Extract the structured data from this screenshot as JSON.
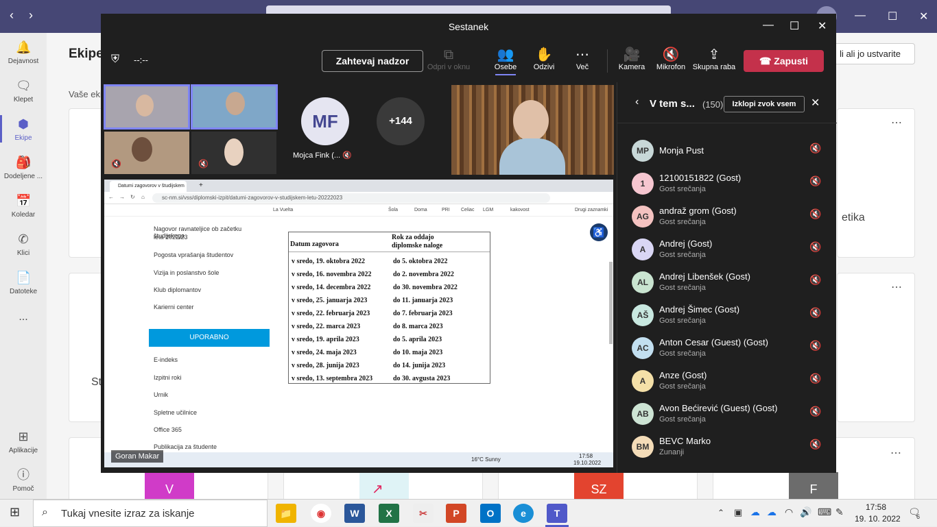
{
  "teams": {
    "page_title": "Ekipe",
    "your_teams_label": "Vaše ekipe",
    "join_create_label": "li ali jo ustvarite",
    "partial_card_text": "etika",
    "partial_card_text2": "St",
    "rail": [
      {
        "label": "Dejavnost",
        "icon": "bell-icon"
      },
      {
        "label": "Klepet",
        "icon": "chat-icon"
      },
      {
        "label": "Ekipe",
        "icon": "teams-icon"
      },
      {
        "label": "Dodeljene ...",
        "icon": "assignments-icon"
      },
      {
        "label": "Koledar",
        "icon": "calendar-icon"
      },
      {
        "label": "Klici",
        "icon": "phone-icon"
      },
      {
        "label": "Datoteke",
        "icon": "file-icon"
      },
      {
        "label": "...",
        "icon": "more-icon"
      },
      {
        "label": "Aplikacije",
        "icon": "apps-icon"
      },
      {
        "label": "Pomoč",
        "icon": "help-icon"
      }
    ],
    "card_letters": [
      "V",
      "SZ",
      "F"
    ]
  },
  "meeting": {
    "title": "Sestanek",
    "timer": "--:--",
    "request_control": "Zahtevaj nadzor",
    "toolbar": [
      {
        "label": "Odpri v oknu",
        "icon": "popout-icon",
        "disabled": true
      },
      {
        "label": "Osebe",
        "icon": "people-icon"
      },
      {
        "label": "Odzivi",
        "icon": "hand-icon"
      },
      {
        "label": "Več",
        "icon": "more-icon"
      },
      {
        "label": "Kamera",
        "icon": "camera-icon"
      },
      {
        "label": "Mikrofon",
        "icon": "mic-off-icon"
      },
      {
        "label": "Skupna raba",
        "icon": "share-icon"
      }
    ],
    "leave_label": "Zapusti",
    "tiles": {
      "mf_initials": "MF",
      "mf_name": "Mojca Fink (...",
      "more_count": "+144"
    },
    "presenter": "Goran Makar"
  },
  "shared_screen": {
    "tab_title": "Datumi zagovorov v študijskem",
    "url": "sc-nm.si/vss/diplomski-izpit/datumi-zagovorov-v-studijskem-letu-20222023",
    "bookmarks": [
      "La Vuelta",
      "Šola",
      "Doma",
      "PRI",
      "Celiac",
      "LGM",
      "kakovost",
      "Drugi zaznamki"
    ],
    "sidebar_top": [
      "Nagovor ravnateljice ob začetku študijskega",
      "leta 2022/23",
      "Pogosta vprašanja študentov",
      "Vizija in poslanstvo šole",
      "Klub diplomantov",
      "Karierni center"
    ],
    "uporabno": "UPORABNO",
    "sidebar_bottom": [
      "E-indeks",
      "Izpitni roki",
      "Urnik",
      "Spletne učilnice",
      "Office 365",
      "Publikacija za študente"
    ],
    "table_headers": [
      "Datum zagovora",
      "Rok za oddajo",
      "diplomske naloge"
    ],
    "table_rows": [
      [
        "v sredo, 19. oktobra 2022",
        "do 5. oktobra 2022"
      ],
      [
        "v sredo, 16. novembra 2022",
        "do 2. novembra 2022"
      ],
      [
        "v sredo, 14. decembra 2022",
        "do 30. novembra 2022"
      ],
      [
        "v sredo, 25. januarja 2023",
        "do 11. januarja 2023"
      ],
      [
        "v sredo, 22. februarja 2023",
        "do 7. februarja 2023"
      ],
      [
        "v sredo, 22. marca 2023",
        "do 8. marca 2023"
      ],
      [
        "v sredo, 19. aprila 2023",
        "do 5. aprila 2023"
      ],
      [
        "v sredo, 24. maja 2023",
        "do 10. maja 2023"
      ],
      [
        "v sredo, 28. junija 2023",
        "do 14. junija 2023"
      ],
      [
        "v sredo, 13. septembra 2023",
        "do 30. avgusta 2023"
      ]
    ],
    "weather": "16°C Sunny",
    "time": "17:58",
    "date": "19.10.2022"
  },
  "panel": {
    "title": "V tem s...",
    "count": "(150)",
    "mute_all": "Izklopi zvok vsem",
    "participants": [
      {
        "initials": "MP",
        "name": "Monja Pust",
        "sub": "",
        "color": "#c8d8d8"
      },
      {
        "initials": "1",
        "name": "12100151822 (Gost)",
        "sub": "Gost srečanja",
        "color": "#f6c6d0"
      },
      {
        "initials": "AG",
        "name": "andraž grom (Gost)",
        "sub": "Gost srečanja",
        "color": "#f4c2c0"
      },
      {
        "initials": "A",
        "name": "Andrej (Gost)",
        "sub": "Gost srečanja",
        "color": "#d9d6f4"
      },
      {
        "initials": "AL",
        "name": "Andrej Libenšek (Gost)",
        "sub": "Gost srečanja",
        "color": "#c9e4d0"
      },
      {
        "initials": "AŠ",
        "name": "Andrej Šimec (Gost)",
        "sub": "Gost srečanja",
        "color": "#c8e8e0"
      },
      {
        "initials": "AC",
        "name": "Anton Cesar (Guest) (Gost)",
        "sub": "Gost srečanja",
        "color": "#c2dff0"
      },
      {
        "initials": "A",
        "name": "Anze (Gost)",
        "sub": "Gost srečanja",
        "color": "#f4e0a8"
      },
      {
        "initials": "AB",
        "name": "Avon Bećirević (Guest) (Gost)",
        "sub": "Gost srečanja",
        "color": "#cde4d4"
      },
      {
        "initials": "BM",
        "name": "BEVC Marko",
        "sub": "Zunanji",
        "color": "#f4dcb8"
      }
    ]
  },
  "taskbar": {
    "search_placeholder": "Tukaj vnesite izraz za iskanje",
    "time": "17:58",
    "date": "19. 10. 2022",
    "notifications": "6"
  }
}
